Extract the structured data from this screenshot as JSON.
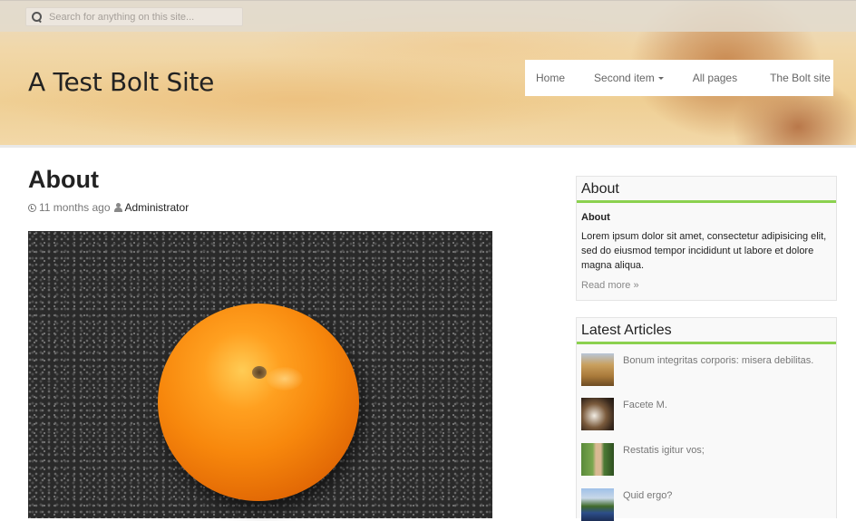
{
  "search": {
    "placeholder": "Search for anything on this site..."
  },
  "site": {
    "title": "A Test Bolt Site"
  },
  "nav": {
    "items": [
      {
        "label": "Home"
      },
      {
        "label": "Second item",
        "has_dropdown": true
      },
      {
        "label": "All pages"
      },
      {
        "label": "The Bolt site"
      }
    ]
  },
  "page": {
    "title": "About",
    "date": "11 months ago",
    "author": "Administrator",
    "image_subject": "orange on dark textured surface"
  },
  "sidebar": {
    "about": {
      "heading": "About",
      "subheading": "About",
      "text": "Lorem ipsum dolor sit amet, consectetur adipisicing elit, sed do eiusmod tempor incididunt ut labore et dolore magna aliqua.",
      "read_more": "Read more »"
    },
    "latest": {
      "heading": "Latest Articles",
      "items": [
        {
          "title": "Bonum integritas corporis: misera debilitas."
        },
        {
          "title": "Facete M."
        },
        {
          "title": "Restatis igitur vos;"
        },
        {
          "title": "Quid ergo?"
        }
      ]
    }
  },
  "colors": {
    "accent": "#8bd14f",
    "nav_bg": "#ffffff"
  }
}
